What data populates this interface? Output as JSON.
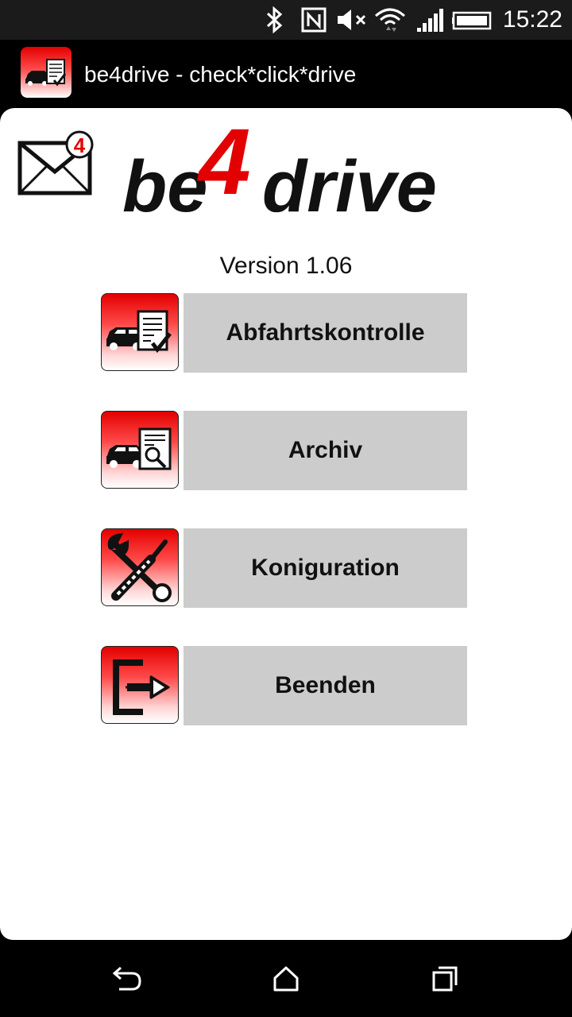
{
  "status_bar": {
    "time": "15:22",
    "icons": [
      "bluetooth-icon",
      "nfc-icon",
      "volume-muted-icon",
      "wifi-icon",
      "signal-icon",
      "battery-icon"
    ]
  },
  "title_bar": {
    "title": "be4drive - check*click*drive",
    "app_icon": "car-checklist-icon"
  },
  "header": {
    "mail_badge": "4",
    "logo": {
      "part1": "be",
      "part2": "4",
      "part3": "drive"
    },
    "version": "Version 1.06"
  },
  "menu": [
    {
      "label": "Abfahrtskontrolle",
      "icon": "car-checklist-icon"
    },
    {
      "label": "Archiv",
      "icon": "car-search-document-icon"
    },
    {
      "label": "Koniguration",
      "icon": "wrench-screwdriver-icon"
    },
    {
      "label": "Beenden",
      "icon": "exit-door-icon"
    }
  ],
  "nav_bar": [
    "back-icon",
    "home-icon",
    "recent-apps-icon"
  ],
  "colors": {
    "brand_red": "#e30000",
    "button_gray": "#cccccc"
  }
}
